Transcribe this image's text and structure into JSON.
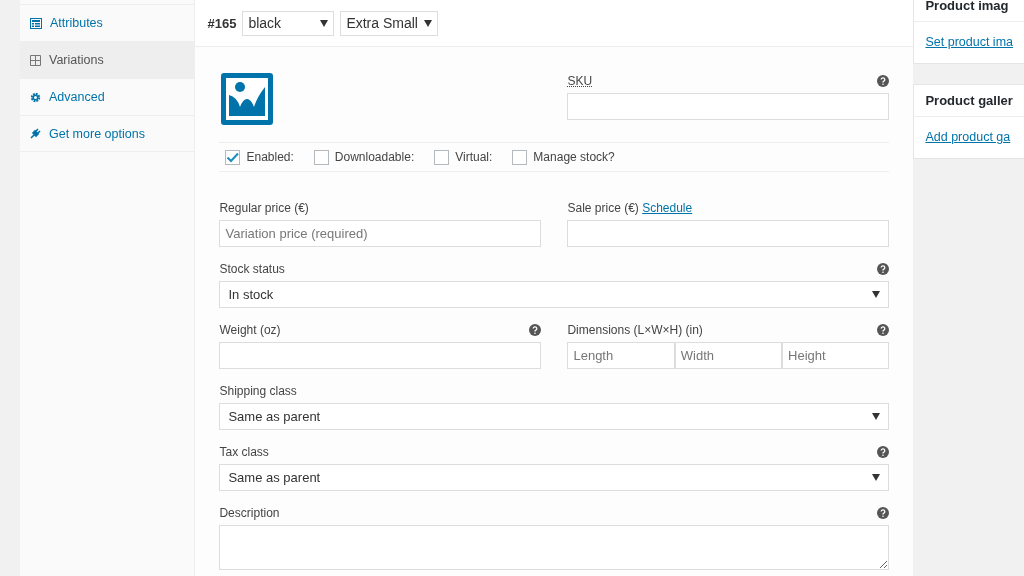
{
  "sidebar": {
    "items": [
      {
        "label": "Attributes",
        "selected": false
      },
      {
        "label": "Variations",
        "selected": true
      },
      {
        "label": "Advanced",
        "selected": false
      },
      {
        "label": "Get more options",
        "selected": false
      }
    ]
  },
  "variation": {
    "number": "#165",
    "attributes": [
      {
        "value": "black"
      },
      {
        "value": "Extra Small"
      }
    ],
    "sku": {
      "label": "SKU",
      "help": true
    },
    "options": [
      {
        "label": "Enabled:",
        "checked": true
      },
      {
        "label": "Downloadable:",
        "checked": false
      },
      {
        "label": "Virtual:",
        "checked": false
      },
      {
        "label": "Manage stock?",
        "checked": false
      }
    ],
    "rows": [
      [
        {
          "kind": "text",
          "label": "Regular price (€)",
          "help": false,
          "placeholder": "Variation price (required)"
        },
        {
          "kind": "text",
          "label": "Sale price (€)",
          "link": "Schedule",
          "help": false
        }
      ],
      [
        {
          "kind": "select",
          "label": "Stock status",
          "help": true,
          "value": "In stock"
        }
      ],
      [
        {
          "kind": "text",
          "label": "Weight (oz)",
          "help": true
        },
        {
          "kind": "dimensions",
          "label": "Dimensions (L×W×H) (in)",
          "help": true,
          "placeholders": [
            "Length",
            "Width",
            "Height"
          ]
        }
      ],
      [
        {
          "kind": "select",
          "label": "Shipping class",
          "help": false,
          "value": "Same as parent"
        }
      ],
      [
        {
          "kind": "select",
          "label": "Tax class",
          "help": true,
          "value": "Same as parent"
        }
      ],
      [
        {
          "kind": "textarea",
          "label": "Description",
          "help": true
        }
      ]
    ]
  },
  "side_boxes": [
    {
      "title": "Product imag",
      "link": "Set product ima"
    },
    {
      "title": "Product galler",
      "link": "Add product ga"
    }
  ]
}
